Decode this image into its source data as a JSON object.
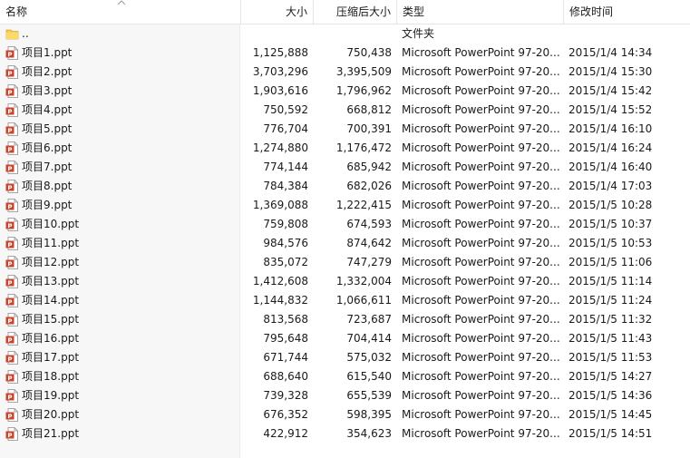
{
  "columns": {
    "name": "名称",
    "size": "大小",
    "packed": "压缩后大小",
    "type": "类型",
    "modified": "修改时间"
  },
  "parent": {
    "name": "..",
    "type": "文件夹"
  },
  "files": [
    {
      "name": "项目1.ppt",
      "size": "1,125,888",
      "packed": "750,438",
      "type": "Microsoft PowerPoint 97-20...",
      "modified": "2015/1/4 14:34"
    },
    {
      "name": "项目2.ppt",
      "size": "3,703,296",
      "packed": "3,395,509",
      "type": "Microsoft PowerPoint 97-20...",
      "modified": "2015/1/4 15:30"
    },
    {
      "name": "项目3.ppt",
      "size": "1,903,616",
      "packed": "1,796,962",
      "type": "Microsoft PowerPoint 97-20...",
      "modified": "2015/1/4 15:42"
    },
    {
      "name": "项目4.ppt",
      "size": "750,592",
      "packed": "668,812",
      "type": "Microsoft PowerPoint 97-20...",
      "modified": "2015/1/4 15:52"
    },
    {
      "name": "项目5.ppt",
      "size": "776,704",
      "packed": "700,391",
      "type": "Microsoft PowerPoint 97-20...",
      "modified": "2015/1/4 16:10"
    },
    {
      "name": "项目6.ppt",
      "size": "1,274,880",
      "packed": "1,176,472",
      "type": "Microsoft PowerPoint 97-20...",
      "modified": "2015/1/4 16:24"
    },
    {
      "name": "项目7.ppt",
      "size": "774,144",
      "packed": "685,942",
      "type": "Microsoft PowerPoint 97-20...",
      "modified": "2015/1/4 16:40"
    },
    {
      "name": "项目8.ppt",
      "size": "784,384",
      "packed": "682,026",
      "type": "Microsoft PowerPoint 97-20...",
      "modified": "2015/1/4 17:03"
    },
    {
      "name": "项目9.ppt",
      "size": "1,369,088",
      "packed": "1,222,415",
      "type": "Microsoft PowerPoint 97-20...",
      "modified": "2015/1/5 10:28"
    },
    {
      "name": "项目10.ppt",
      "size": "759,808",
      "packed": "674,593",
      "type": "Microsoft PowerPoint 97-20...",
      "modified": "2015/1/5 10:37"
    },
    {
      "name": "项目11.ppt",
      "size": "984,576",
      "packed": "874,642",
      "type": "Microsoft PowerPoint 97-20...",
      "modified": "2015/1/5 10:53"
    },
    {
      "name": "项目12.ppt",
      "size": "835,072",
      "packed": "747,279",
      "type": "Microsoft PowerPoint 97-20...",
      "modified": "2015/1/5 11:06"
    },
    {
      "name": "项目13.ppt",
      "size": "1,412,608",
      "packed": "1,332,004",
      "type": "Microsoft PowerPoint 97-20...",
      "modified": "2015/1/5 11:14"
    },
    {
      "name": "项目14.ppt",
      "size": "1,144,832",
      "packed": "1,066,611",
      "type": "Microsoft PowerPoint 97-20...",
      "modified": "2015/1/5 11:24"
    },
    {
      "name": "项目15.ppt",
      "size": "813,568",
      "packed": "723,687",
      "type": "Microsoft PowerPoint 97-20...",
      "modified": "2015/1/5 11:32"
    },
    {
      "name": "项目16.ppt",
      "size": "795,648",
      "packed": "704,414",
      "type": "Microsoft PowerPoint 97-20...",
      "modified": "2015/1/5 11:43"
    },
    {
      "name": "项目17.ppt",
      "size": "671,744",
      "packed": "575,032",
      "type": "Microsoft PowerPoint 97-20...",
      "modified": "2015/1/5 11:53"
    },
    {
      "name": "项目18.ppt",
      "size": "688,640",
      "packed": "615,540",
      "type": "Microsoft PowerPoint 97-20...",
      "modified": "2015/1/5 14:27"
    },
    {
      "name": "项目19.ppt",
      "size": "739,328",
      "packed": "655,539",
      "type": "Microsoft PowerPoint 97-20...",
      "modified": "2015/1/5 14:36"
    },
    {
      "name": "项目20.ppt",
      "size": "676,352",
      "packed": "598,395",
      "type": "Microsoft PowerPoint 97-20...",
      "modified": "2015/1/5 14:45"
    },
    {
      "name": "项目21.ppt",
      "size": "422,912",
      "packed": "354,623",
      "type": "Microsoft PowerPoint 97-20...",
      "modified": "2015/1/5 14:51"
    }
  ],
  "icons": {
    "parent": "folder-icon",
    "file": "powerpoint-file-icon",
    "sort": "sort-ascending-icon"
  },
  "colors": {
    "folder": "#f5c84c",
    "ppt_red": "#c9442c",
    "header_border": "#e5e5e5",
    "name_column_bg": "#f7f7f7"
  }
}
